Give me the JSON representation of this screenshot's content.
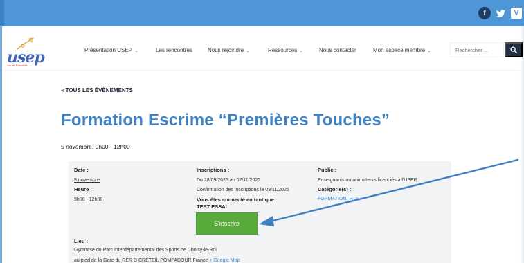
{
  "topbar": {
    "social": {
      "facebook_glyph": "f",
      "twitter_glyph": "🐦",
      "vimeo_glyph": "V"
    }
  },
  "brand": {
    "logo_text": "usep",
    "logo_subtext": "Val-de-Marne 94"
  },
  "nav": {
    "items": [
      {
        "label": "Présentation USEP",
        "has_dropdown": true
      },
      {
        "label": "Les rencontres",
        "has_dropdown": false
      },
      {
        "label": "Nous rejoindre",
        "has_dropdown": true
      },
      {
        "label": "Ressources",
        "has_dropdown": true
      },
      {
        "label": "Nous contacter",
        "has_dropdown": false
      },
      {
        "label": "Mon espace membre",
        "has_dropdown": true
      }
    ],
    "chevron": "⌄",
    "search_placeholder": "Rechercher ...",
    "search_icon": "magnifier-icon"
  },
  "event": {
    "back_label": "« TOUS LES ÉVÈNEMENTS",
    "title": "Formation Escrime “Premières Touches”",
    "date_line": "5 novembre, 9h00 - 12h00",
    "details": {
      "date_label": "Date :",
      "date_value": "5 novembre",
      "hour_label": "Heure :",
      "hour_value": "9h00 - 12h00",
      "inscriptions_label": "Inscriptions :",
      "inscriptions_period": "Du 28/09/2025 au 02/11/2025",
      "inscriptions_confirm": "Confirmation des inscriptions le 03/11/2025",
      "connected_label": "Vous êtes connecté en tant que :",
      "connected_user": "TEST ESSAI",
      "public_label": "Public :",
      "public_value": "Enseignants ou animateurs licenciés à l'USEP",
      "categories_label": "Catégorie(s) :",
      "categories_value": "FORMATION, HTS",
      "lieu_label": "Lieu :",
      "lieu_line1": "Gymnase du Parc Interdépartemental des Sports de Choisy-le-Roi",
      "lieu_line2": "au pied de la Gare du RER D CRETEIL POMPADOUR France",
      "map_link": "+ Google Map"
    },
    "register_button": "S'inscrire"
  },
  "colors": {
    "topbar": "#4f96d6",
    "title_blue": "#3c82c4",
    "button_green": "#58aa3a",
    "annotation_arrow": "#3d7fc1"
  }
}
